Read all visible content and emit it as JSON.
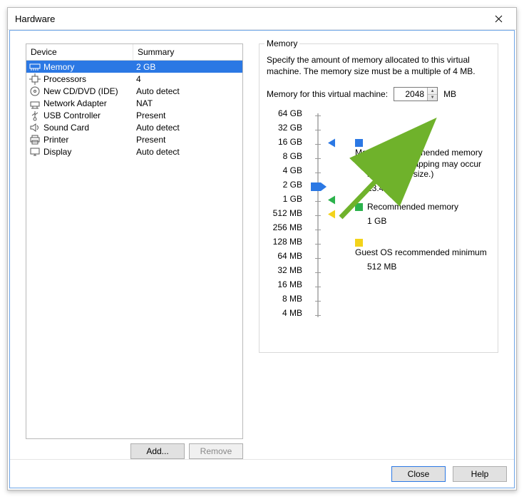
{
  "window": {
    "title": "Hardware"
  },
  "list": {
    "head_device": "Device",
    "head_summary": "Summary",
    "rows": [
      {
        "name": "Memory",
        "summary": "2 GB",
        "icon": "memory-icon",
        "selected": true
      },
      {
        "name": "Processors",
        "summary": "4",
        "icon": "cpu-icon",
        "selected": false
      },
      {
        "name": "New CD/DVD (IDE)",
        "summary": "Auto detect",
        "icon": "disc-icon",
        "selected": false
      },
      {
        "name": "Network Adapter",
        "summary": "NAT",
        "icon": "network-icon",
        "selected": false
      },
      {
        "name": "USB Controller",
        "summary": "Present",
        "icon": "usb-icon",
        "selected": false
      },
      {
        "name": "Sound Card",
        "summary": "Auto detect",
        "icon": "sound-icon",
        "selected": false
      },
      {
        "name": "Printer",
        "summary": "Present",
        "icon": "printer-icon",
        "selected": false
      },
      {
        "name": "Display",
        "summary": "Auto detect",
        "icon": "display-icon",
        "selected": false
      }
    ]
  },
  "left_buttons": {
    "add": "Add...",
    "remove": "Remove"
  },
  "memory_panel": {
    "group_label": "Memory",
    "description": "Specify the amount of memory allocated to this virtual machine. The memory size must be a multiple of 4 MB.",
    "field_label": "Memory for this virtual machine:",
    "value": "2048",
    "unit": "MB",
    "ticks": [
      "64 GB",
      "32 GB",
      "16 GB",
      "8 GB",
      "4 GB",
      "2 GB",
      "1 GB",
      "512 MB",
      "256 MB",
      "128 MB",
      "64 MB",
      "32 MB",
      "16 MB",
      "8 MB",
      "4 MB"
    ],
    "markers": {
      "max_index": 2,
      "current_index": 5,
      "recommended_index": 6,
      "min_index": 7
    },
    "legend": {
      "max": {
        "label": "Maximum recommended memory",
        "sub": "(Memory swapping may occur beyond this size.)",
        "value": "13.4 GB",
        "color": "#2b78e4"
      },
      "rec": {
        "label": "Recommended memory",
        "value": "1 GB",
        "color": "#2bb24c"
      },
      "min": {
        "label": "Guest OS recommended minimum",
        "value": "512 MB",
        "color": "#f3d31a"
      }
    }
  },
  "footer": {
    "close": "Close",
    "help": "Help"
  },
  "annotation": {
    "arrow_color": "#6fb22b"
  }
}
